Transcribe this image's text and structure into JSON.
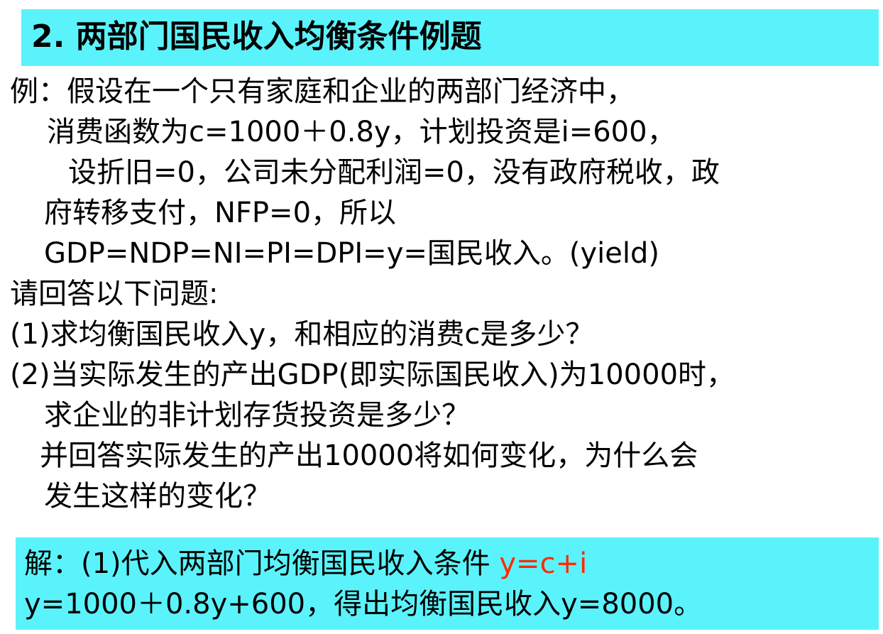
{
  "title": "2. 两部门国民收入均衡条件例题",
  "problem": {
    "line1": "例：假设在一个只有家庭和企业的两部门经济中，",
    "line2": "消费函数为c=1000＋0.8y，计划投资是i=600，",
    "line3": "设折旧=0，公司未分配利润=0，没有政府税收，政",
    "line4": "府转移支付，NFP=0，所以",
    "line5": "GDP=NDP=NI=PI=DPI=y=国民收入。(yield)"
  },
  "questions": {
    "intro": "请回答以下问题:",
    "q1": "(1)求均衡国民收入y，和相应的消费c是多少？",
    "q2a": "(2)当实际发生的产出GDP(即实际国民收入)为10000时，",
    "q2b": "求企业的非计划存货投资是多少？",
    "q2c": "并回答实际发生的产出10000将如何变化，为什么会",
    "q2d": "发生这样的变化？"
  },
  "solution": {
    "line1_prefix": "解：(1)代入两部门均衡国民收入条件 ",
    "line1_formula": "y=c+i",
    "line2": "y=1000＋0.8y+600，得出均衡国民收入y=8000。"
  },
  "colors": {
    "highlight_bg": "#5bf3fb",
    "formula_red": "#ff2a00"
  }
}
